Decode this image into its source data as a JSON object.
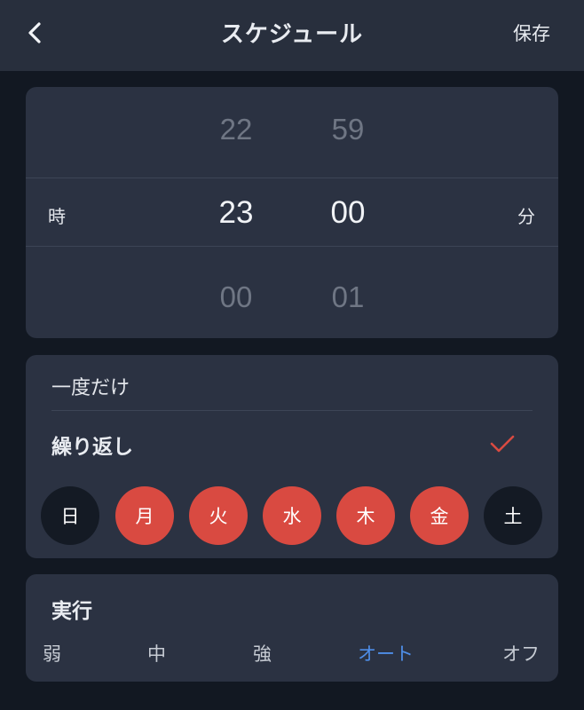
{
  "header": {
    "title": "スケジュール",
    "save_label": "保存"
  },
  "picker": {
    "hour_unit": "時",
    "minute_unit": "分",
    "hours": [
      "22",
      "23",
      "00"
    ],
    "minutes": [
      "59",
      "00",
      "01"
    ],
    "selected_hour": "23",
    "selected_minute": "00"
  },
  "repeat": {
    "once_label": "一度だけ",
    "repeat_label": "繰り返し",
    "repeat_checked": true,
    "days": [
      {
        "label": "日",
        "selected": false
      },
      {
        "label": "月",
        "selected": true
      },
      {
        "label": "火",
        "selected": true
      },
      {
        "label": "水",
        "selected": true
      },
      {
        "label": "木",
        "selected": true
      },
      {
        "label": "金",
        "selected": true
      },
      {
        "label": "土",
        "selected": false
      }
    ]
  },
  "execution": {
    "title": "実行",
    "modes": [
      "弱",
      "中",
      "強",
      "オート",
      "オフ"
    ],
    "active_mode": "オート"
  },
  "colors": {
    "accent_red": "#d94a41",
    "accent_blue": "#4e8ee8",
    "card_bg": "#2b3242",
    "page_bg": "#121822"
  },
  "icons": {
    "back": "chevron-left-icon",
    "check": "check-icon"
  }
}
